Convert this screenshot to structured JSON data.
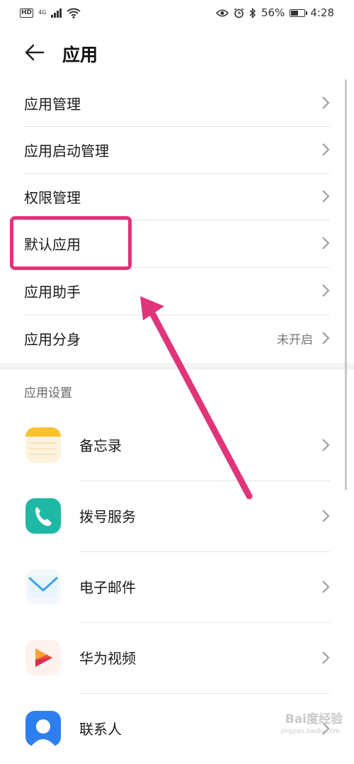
{
  "status_bar": {
    "hd": "HD",
    "network": "4G",
    "battery_percent": "56%",
    "battery_level": 0.56,
    "time": "4:28"
  },
  "header": {
    "title": "应用"
  },
  "menu": [
    {
      "label": "应用管理"
    },
    {
      "label": "应用启动管理"
    },
    {
      "label": "权限管理"
    },
    {
      "label": "默认应用"
    },
    {
      "label": "应用助手"
    },
    {
      "label": "应用分身",
      "value": "未开启"
    }
  ],
  "section": {
    "title": "应用设置"
  },
  "apps": [
    {
      "label": "备忘录",
      "icon": "notepad-icon"
    },
    {
      "label": "拨号服务",
      "icon": "phone-icon"
    },
    {
      "label": "电子邮件",
      "icon": "mail-icon"
    },
    {
      "label": "华为视频",
      "icon": "video-icon"
    },
    {
      "label": "联系人",
      "icon": "contacts-icon"
    }
  ],
  "colors": {
    "highlight": "#e0357a",
    "phone_icon_bg": "#1fb8a5",
    "mail_icon": "#3ba3ee",
    "contacts_icon_bg": "#2d7ff0"
  },
  "watermark": {
    "text": "Bai度经验",
    "sub": "jingyan.baidu.com"
  }
}
